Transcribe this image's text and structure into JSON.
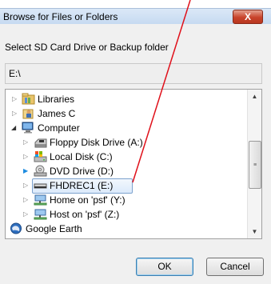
{
  "dialog": {
    "title": "Browse for Files or Folders",
    "close_label": "X",
    "prompt": "Select SD Card Drive or Backup folder",
    "path": "E:\\"
  },
  "tree": {
    "items": [
      {
        "label": "Libraries",
        "icon": "library-icon",
        "expander": "collapsed"
      },
      {
        "label": "James C",
        "icon": "user-folder-icon",
        "expander": "collapsed"
      },
      {
        "label": "Computer",
        "icon": "computer-icon",
        "expander": "expanded"
      },
      {
        "label": "Floppy Disk Drive (A:)",
        "icon": "floppy-drive-icon",
        "expander": "collapsed"
      },
      {
        "label": "Local Disk (C:)",
        "icon": "hard-disk-icon",
        "expander": "collapsed"
      },
      {
        "label": "DVD Drive (D:)",
        "icon": "dvd-drive-icon",
        "expander": "collapsed"
      },
      {
        "label": "FHDREC1 (E:)",
        "icon": "removable-drive-icon",
        "expander": "collapsed",
        "selected": true
      },
      {
        "label": "Home on 'psf' (Y:)",
        "icon": "network-drive-icon",
        "expander": "collapsed"
      },
      {
        "label": "Host on 'psf' (Z:)",
        "icon": "network-drive-icon",
        "expander": "collapsed"
      },
      {
        "label": "Google Earth",
        "icon": "google-earth-icon",
        "expander": "none"
      }
    ]
  },
  "buttons": {
    "ok": "OK",
    "cancel": "Cancel"
  },
  "colors": {
    "selection_border": "#7da2ce",
    "close_button": "#c8432b",
    "annotation_arrow": "#e0101a"
  }
}
